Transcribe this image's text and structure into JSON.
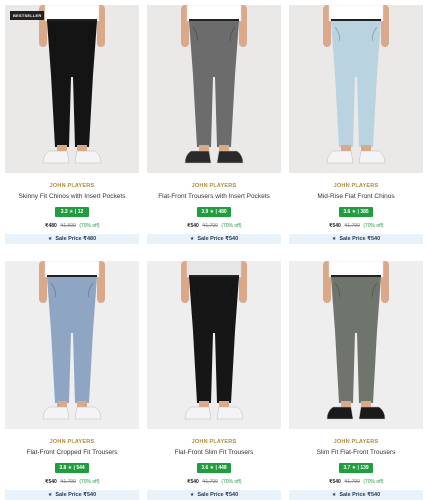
{
  "products": [
    {
      "tag": "BESTSELLER",
      "brand": "JOHN PLAYERS",
      "name": "Skinny Fit Chinos with Insert Pockets",
      "rating": "3.3 ★ | 12",
      "price": "₹480",
      "mrp": "₹1,599",
      "discount": "(70% off)",
      "sale_label": "Sale Price ₹480",
      "colors": {
        "pant": "#141414",
        "shirt": "#ffffff",
        "shoe": "#f4f4f4",
        "bg": "#ebe9e7"
      }
    },
    {
      "tag": "",
      "brand": "JOHN PLAYERS",
      "name": "Flat-Front Trousers with Insert Pockets",
      "rating": "3.9 ★ | 480",
      "price": "₹540",
      "mrp": "₹1,799",
      "discount": "(70% off)",
      "sale_label": "Sale Price ₹540",
      "colors": {
        "pant": "#6c6c6c",
        "shirt": "#ffffff",
        "shoe": "#2a2a2a",
        "bg": "#ebe9e7"
      }
    },
    {
      "tag": "",
      "brand": "JOHN PLAYERS",
      "name": "Mid-Rise Flat Front Chinos",
      "rating": "3.6 ★ | 385",
      "price": "₹540",
      "mrp": "₹1,799",
      "discount": "(70% off)",
      "sale_label": "Sale Price ₹540",
      "colors": {
        "pant": "#b9d4e0",
        "shirt": "#ffffff",
        "shoe": "#f4f4f4",
        "bg": "#ebe9e7"
      }
    },
    {
      "tag": "",
      "brand": "JOHN PLAYERS",
      "name": "Flat-Front Cropped Fit Trousers",
      "rating": "3.8 ★ | 544",
      "price": "₹540",
      "mrp": "₹1,799",
      "discount": "(70% off)",
      "sale_label": "Sale Price ₹540",
      "colors": {
        "pant": "#8ea6c3",
        "shirt": "#ffffff",
        "shoe": "#f4f4f4",
        "bg": "#eeeeee"
      }
    },
    {
      "tag": "",
      "brand": "JOHN PLAYERS",
      "name": "Flat-Front Slim Fit Trousers",
      "rating": "3.6 ★ | 448",
      "price": "₹540",
      "mrp": "₹1,799",
      "discount": "(70% off)",
      "sale_label": "Sale Price ₹540",
      "colors": {
        "pant": "#161616",
        "shirt": "#e6e6e6",
        "shoe": "#f4f4f4",
        "bg": "#eeeeee"
      }
    },
    {
      "tag": "",
      "brand": "JOHN PLAYERS",
      "name": "Slim Fit Flat-Front Trousers",
      "rating": "3.7 ★ | 139",
      "price": "₹540",
      "mrp": "₹1,799",
      "discount": "(70% off)",
      "sale_label": "Sale Price ₹540",
      "colors": {
        "pant": "#6f756c",
        "shirt": "#ffffff",
        "shoe": "#1a1a1a",
        "bg": "#eeeeee"
      }
    }
  ]
}
